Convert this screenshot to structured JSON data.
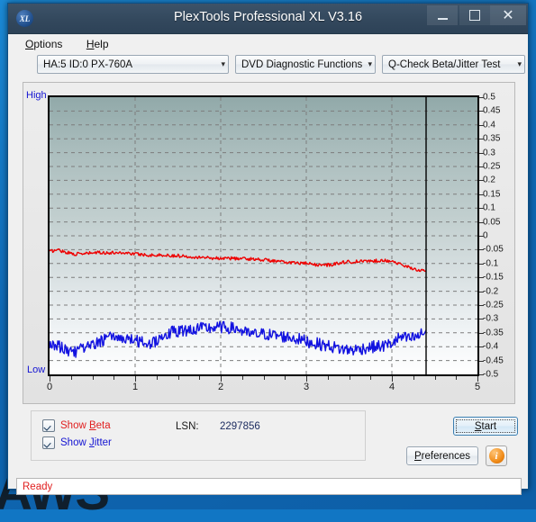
{
  "window": {
    "title": "PlexTools Professional XL V3.16",
    "icon": "xl-app-icon",
    "controls": {
      "minimize": "minimize-icon",
      "maximize": "maximize-icon",
      "close": "close-icon"
    }
  },
  "menubar": {
    "items": [
      {
        "label": "Options",
        "accel": "O"
      },
      {
        "label": "Help",
        "accel": "H"
      }
    ]
  },
  "toolbar": {
    "drive": "HA:5 ID:0  PX-760A",
    "function": "DVD Diagnostic Functions",
    "test": "Q-Check Beta/Jitter Test",
    "caret": "⌄"
  },
  "controls": {
    "show_beta": "Show Beta",
    "show_beta_accel": "B",
    "show_jitter": "Show Jitter",
    "show_jitter_accel": "J",
    "lsn_label": "LSN:",
    "lsn_value": "2297856",
    "start": "Start",
    "start_accel": "S",
    "preferences": "Preferences",
    "preferences_accel": "P",
    "info": "i"
  },
  "status": {
    "text": "Ready",
    "color": "#e02020"
  },
  "desktop": {
    "text": "AWS"
  },
  "colors": {
    "beta": "#ee0000",
    "jitter": "#1212e0",
    "axis_label": "#1414d2",
    "titlebar": "#33485d"
  },
  "chart_data": {
    "type": "line",
    "title": "Q-Check Beta/Jitter Test",
    "xlabel": "",
    "ylabel": "",
    "xlim": [
      0,
      5
    ],
    "ylim": [
      -0.5,
      0.5
    ],
    "xticks": [
      0,
      1,
      2,
      3,
      4,
      5
    ],
    "yticks": [
      0.5,
      0.45,
      0.4,
      0.35,
      0.3,
      0.25,
      0.2,
      0.15,
      0.1,
      0.05,
      0,
      -0.05,
      -0.1,
      -0.15,
      -0.2,
      -0.25,
      -0.3,
      -0.35,
      -0.4,
      -0.45,
      -0.5
    ],
    "grid": true,
    "left_axis_high_label": "High",
    "left_axis_low_label": "Low",
    "data_end_x": 4.4,
    "series": [
      {
        "name": "Beta",
        "color": "#ee0000",
        "noise": 0.006,
        "x": [
          0.0,
          0.1,
          0.2,
          0.3,
          0.4,
          0.5,
          0.6,
          0.7,
          0.8,
          0.9,
          1.0,
          1.1,
          1.2,
          1.3,
          1.4,
          1.5,
          1.6,
          1.7,
          1.8,
          1.9,
          2.0,
          2.1,
          2.2,
          2.3,
          2.4,
          2.5,
          2.6,
          2.7,
          2.8,
          2.9,
          3.0,
          3.1,
          3.2,
          3.3,
          3.4,
          3.5,
          3.6,
          3.7,
          3.8,
          3.9,
          4.0,
          4.1,
          4.2,
          4.3,
          4.4
        ],
        "values": [
          -0.057,
          -0.05,
          -0.06,
          -0.066,
          -0.065,
          -0.062,
          -0.06,
          -0.062,
          -0.06,
          -0.062,
          -0.065,
          -0.068,
          -0.07,
          -0.07,
          -0.071,
          -0.072,
          -0.074,
          -0.076,
          -0.078,
          -0.08,
          -0.081,
          -0.081,
          -0.082,
          -0.083,
          -0.084,
          -0.086,
          -0.09,
          -0.094,
          -0.096,
          -0.098,
          -0.1,
          -0.104,
          -0.106,
          -0.104,
          -0.096,
          -0.094,
          -0.093,
          -0.092,
          -0.09,
          -0.089,
          -0.09,
          -0.104,
          -0.114,
          -0.122,
          -0.13
        ]
      },
      {
        "name": "Jitter",
        "color": "#1212e0",
        "noise": 0.022,
        "x": [
          0.0,
          0.1,
          0.2,
          0.3,
          0.4,
          0.5,
          0.6,
          0.7,
          0.8,
          0.9,
          1.0,
          1.1,
          1.2,
          1.3,
          1.4,
          1.5,
          1.6,
          1.7,
          1.8,
          1.9,
          2.0,
          2.1,
          2.2,
          2.3,
          2.4,
          2.5,
          2.6,
          2.7,
          2.8,
          2.9,
          3.0,
          3.1,
          3.2,
          3.3,
          3.4,
          3.5,
          3.6,
          3.7,
          3.8,
          3.9,
          4.0,
          4.1,
          4.2,
          4.3,
          4.4
        ],
        "values": [
          -0.392,
          -0.398,
          -0.412,
          -0.418,
          -0.405,
          -0.398,
          -0.378,
          -0.368,
          -0.366,
          -0.37,
          -0.378,
          -0.386,
          -0.388,
          -0.364,
          -0.35,
          -0.344,
          -0.34,
          -0.336,
          -0.334,
          -0.332,
          -0.33,
          -0.332,
          -0.336,
          -0.352,
          -0.356,
          -0.354,
          -0.358,
          -0.362,
          -0.366,
          -0.372,
          -0.38,
          -0.388,
          -0.394,
          -0.4,
          -0.408,
          -0.412,
          -0.41,
          -0.404,
          -0.4,
          -0.398,
          -0.388,
          -0.366,
          -0.372,
          -0.364,
          -0.344
        ]
      }
    ]
  }
}
